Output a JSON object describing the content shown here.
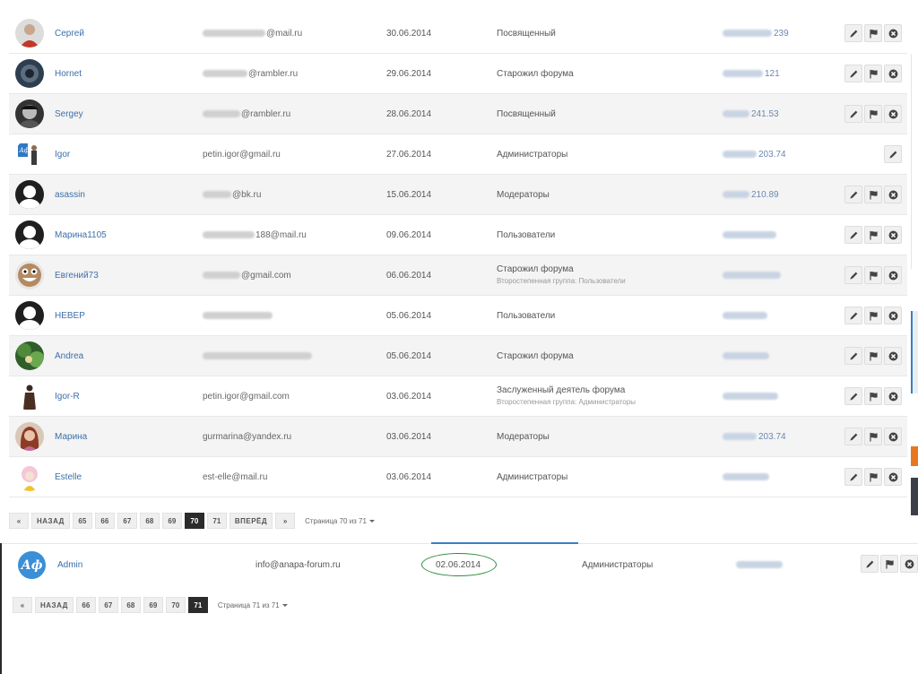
{
  "members": [
    {
      "name": "Сергей",
      "email_visible": "@mail.ru",
      "email_blur": 70,
      "date": "30.06.2014",
      "group": "Посвященный",
      "subgroup": "",
      "ip_visible": "239",
      "ip_blur": 55,
      "avatar": "photo-red",
      "actions": [
        "edit-icon",
        "flag-icon",
        "ban-icon"
      ],
      "alt": false
    },
    {
      "name": "Hornet",
      "email_visible": "@rambler.ru",
      "email_blur": 50,
      "date": "29.06.2014",
      "group": "Старожил форума",
      "subgroup": "",
      "ip_visible": "121",
      "ip_blur": 45,
      "avatar": "photo-dark",
      "actions": [
        "edit-icon",
        "flag-icon",
        "ban-icon"
      ],
      "alt": false
    },
    {
      "name": "Sergey",
      "email_visible": "@rambler.ru",
      "email_blur": 42,
      "date": "28.06.2014",
      "group": "Посвященный",
      "subgroup": "",
      "ip_visible": "241.53",
      "ip_blur": 30,
      "avatar": "photo-bw",
      "actions": [
        "edit-icon",
        "flag-icon",
        "ban-icon"
      ],
      "alt": true
    },
    {
      "name": "Igor",
      "email_visible": "petin.igor@gmail.ru",
      "email_blur": 0,
      "date": "27.06.2014",
      "group": "Администраторы",
      "subgroup": "",
      "ip_visible": "203.74",
      "ip_blur": 38,
      "avatar": "photo-igor",
      "actions": [
        "edit-icon"
      ],
      "alt": false
    },
    {
      "name": "asassin",
      "email_visible": "@bk.ru",
      "email_blur": 32,
      "date": "15.06.2014",
      "group": "Модераторы",
      "subgroup": "",
      "ip_visible": "210.89",
      "ip_blur": 30,
      "avatar": "silhouette",
      "actions": [
        "edit-icon",
        "flag-icon",
        "ban-icon"
      ],
      "alt": true
    },
    {
      "name": "Марина1105",
      "email_visible": "188@mail.ru",
      "email_blur": 58,
      "date": "09.06.2014",
      "group": "Пользователи",
      "subgroup": "",
      "ip_visible": "",
      "ip_blur": 60,
      "avatar": "silhouette",
      "actions": [
        "edit-icon",
        "flag-icon",
        "ban-icon"
      ],
      "alt": false
    },
    {
      "name": "Евгений73",
      "email_visible": "@gmail.com",
      "email_blur": 42,
      "date": "06.06.2014",
      "group": "Старожил форума",
      "subgroup": "Второстепенная группа: Пользователи",
      "ip_visible": "",
      "ip_blur": 65,
      "avatar": "photo-smiley",
      "actions": [
        "edit-icon",
        "flag-icon",
        "ban-icon"
      ],
      "alt": true
    },
    {
      "name": "НЕВЕР",
      "email_visible": "",
      "email_blur": 78,
      "date": "05.06.2014",
      "group": "Пользователи",
      "subgroup": "",
      "ip_visible": "",
      "ip_blur": 50,
      "avatar": "silhouette",
      "actions": [
        "edit-icon",
        "flag-icon",
        "ban-icon"
      ],
      "alt": false
    },
    {
      "name": "Andrea",
      "email_visible": "",
      "email_blur": 122,
      "date": "05.06.2014",
      "group": "Старожил форума",
      "subgroup": "",
      "ip_visible": "",
      "ip_blur": 52,
      "avatar": "photo-green",
      "actions": [
        "edit-icon",
        "flag-icon",
        "ban-icon"
      ],
      "alt": true
    },
    {
      "name": "Igor-R",
      "email_visible": "petin.igor@gmail.com",
      "email_blur": 0,
      "date": "03.06.2014",
      "group": "Заслуженный деятель форума",
      "subgroup": "Второстепенная группа: Администраторы",
      "ip_visible": "",
      "ip_blur": 62,
      "avatar": "photo-figure",
      "actions": [
        "edit-icon",
        "flag-icon",
        "ban-icon"
      ],
      "alt": false
    },
    {
      "name": "Марина",
      "email_visible": "gurmarina@yandex.ru",
      "email_blur": 0,
      "date": "03.06.2014",
      "group": "Модераторы",
      "subgroup": "",
      "ip_visible": "203.74",
      "ip_blur": 38,
      "avatar": "photo-woman",
      "actions": [
        "edit-icon",
        "flag-icon",
        "ban-icon"
      ],
      "alt": true
    },
    {
      "name": "Estelle",
      "email_visible": "est-elle@mail.ru",
      "email_blur": 0,
      "date": "03.06.2014",
      "group": "Администраторы",
      "subgroup": "",
      "ip_visible": "",
      "ip_blur": 52,
      "avatar": "photo-anime",
      "actions": [
        "edit-icon",
        "flag-icon",
        "ban-icon"
      ],
      "alt": false
    }
  ],
  "pager1": {
    "prev_icon": "«",
    "prev": "НАЗАД",
    "pages": [
      "65",
      "66",
      "67",
      "68",
      "69",
      "70",
      "71"
    ],
    "active": "70",
    "next": "ВПЕРЁД",
    "next_icon": "»",
    "info": "Страница 70 из 71"
  },
  "admin_row": {
    "avatar_text": "Аф",
    "name": "Admin",
    "email": "info@anapa-forum.ru",
    "date": "02.06.2014",
    "group": "Администраторы",
    "ip_blur": 52,
    "actions": [
      "edit-icon",
      "flag-icon",
      "ban-icon"
    ]
  },
  "pager2": {
    "prev_icon": "«",
    "prev": "НАЗАД",
    "pages": [
      "66",
      "67",
      "68",
      "69",
      "70",
      "71"
    ],
    "active": "71",
    "info": "Страница 71 из 71"
  },
  "colors": {
    "link": "#3d6fa8",
    "accent": "#3a7fc0",
    "highlight_ellipse": "#2e8b3a",
    "edge_orange": "#e87722"
  }
}
